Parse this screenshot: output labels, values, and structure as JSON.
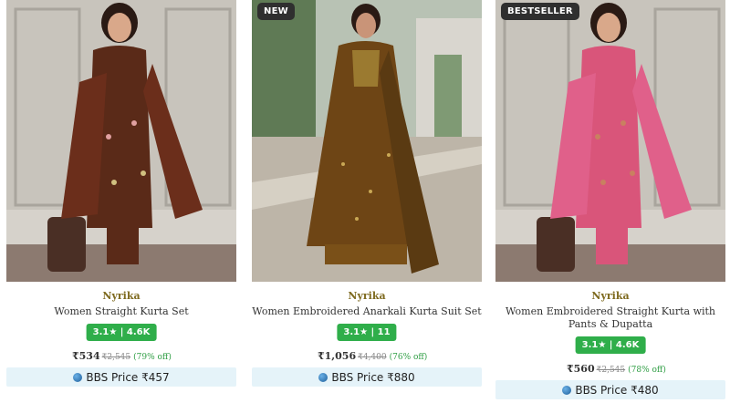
{
  "products": [
    {
      "badge": "",
      "brand": "Nyrika",
      "title": "Women Straight Kurta Set",
      "rating": "3.1★ | 4.6K",
      "price": "₹534",
      "mrp": "₹2,545",
      "discount": "(79% off)",
      "bbs_price": "BBS Price ₹457"
    },
    {
      "badge": "NEW",
      "brand": "Nyrika",
      "title": "Women Embroidered Anarkali Kurta Suit Set",
      "rating": "3.1★ | 11",
      "price": "₹1,056",
      "mrp": "₹4,400",
      "discount": "(76% off)",
      "bbs_price": "BBS Price ₹880"
    },
    {
      "badge": "BESTSELLER",
      "brand": "Nyrika",
      "title": "Women Embroidered Straight Kurta with Pants & Dupatta",
      "rating": "3.1★ | 4.6K",
      "price": "₹560",
      "mrp": "₹2,545",
      "discount": "(78% off)",
      "bbs_price": "BBS Price ₹480"
    }
  ],
  "colors": {
    "brand_text": "#7e6a1f",
    "rating_bg": "#2fae4a",
    "bbs_bg": "#e5f3f9"
  }
}
